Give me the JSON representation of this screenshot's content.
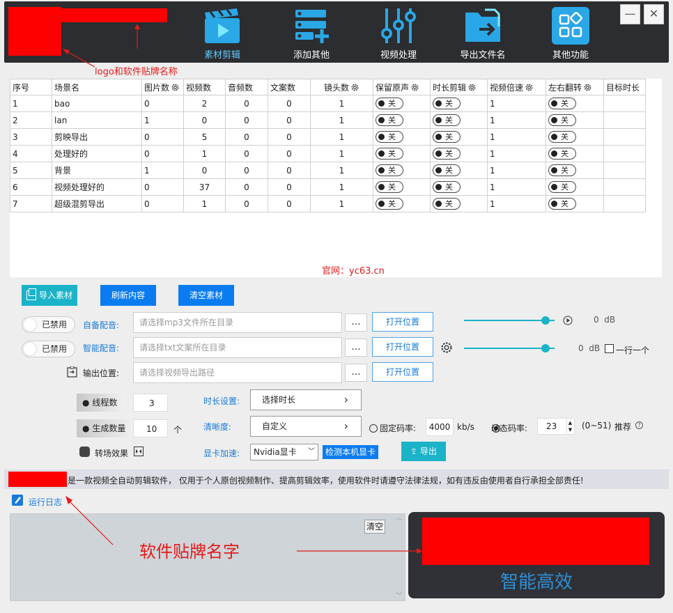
{
  "header": {
    "nav": [
      {
        "label": "素材剪辑",
        "icon": "clapperboard-play-icon",
        "active": true
      },
      {
        "label": "添加其他",
        "icon": "add-list-icon",
        "active": false
      },
      {
        "label": "视频处理",
        "icon": "sliders-icon",
        "active": false
      },
      {
        "label": "导出文件名",
        "icon": "folder-export-icon",
        "active": false
      },
      {
        "label": "其他功能",
        "icon": "grid-apps-icon",
        "active": false
      }
    ],
    "minimize": "—",
    "close": "✕"
  },
  "annotations": {
    "logo_note": "logo和软件贴牌名称",
    "brand_note": "软件贴牌名字",
    "website": "官网：yc63.cn"
  },
  "table": {
    "headers": [
      "序号",
      "场景名",
      "图片数",
      "视频数",
      "音频数",
      "文案数",
      "镜头数",
      "保留原声",
      "时长剪辑",
      "视频倍速",
      "左右翻转",
      "目标时长"
    ],
    "rows": [
      [
        "1",
        "bao",
        "0",
        "2",
        "0",
        "0",
        "1",
        "关",
        "关",
        "1",
        "关",
        ""
      ],
      [
        "2",
        "lan",
        "1",
        "0",
        "0",
        "0",
        "1",
        "关",
        "关",
        "1",
        "关",
        ""
      ],
      [
        "3",
        "剪映导出",
        "0",
        "5",
        "0",
        "0",
        "1",
        "关",
        "关",
        "1",
        "关",
        ""
      ],
      [
        "4",
        "处理好的",
        "0",
        "1",
        "0",
        "0",
        "1",
        "关",
        "关",
        "1",
        "关",
        ""
      ],
      [
        "5",
        "背景",
        "1",
        "0",
        "0",
        "0",
        "1",
        "关",
        "关",
        "1",
        "关",
        ""
      ],
      [
        "6",
        "视频处理好的",
        "0",
        "37",
        "0",
        "0",
        "1",
        "关",
        "关",
        "1",
        "关",
        ""
      ],
      [
        "7",
        "超级混剪导出",
        "0",
        "1",
        "0",
        "0",
        "1",
        "关",
        "关",
        "1",
        "关",
        ""
      ]
    ]
  },
  "actions": {
    "import": "导入素材",
    "refresh": "刷新内容",
    "clear": "清空素材"
  },
  "audio": {
    "self_toggle": "已禁用",
    "self_label": "自备配音:",
    "self_placeholder": "请选择mp3文件所在目录",
    "smart_toggle": "已禁用",
    "smart_label": "智能配音:",
    "smart_placeholder": "请选择txt文案所在目录",
    "browse": "...",
    "open": "打开位置",
    "db1": "0  dB",
    "db2": "0  dB",
    "one_by_one": "一行一个"
  },
  "output": {
    "label": "输出位置:",
    "placeholder": "请选择视频导出路径",
    "open": "打开位置"
  },
  "settings": {
    "threads_label": "线程数",
    "threads": "3",
    "count_label": "生成数量",
    "count": "10",
    "count_unit": "个",
    "transition_label": "转场效果",
    "duration_label": "时长设置:",
    "duration_value": "选择时长",
    "clarity_label": "清晰度:",
    "clarity_value": "自定义",
    "gpu_label": "显卡加速:",
    "gpu_value": "Nvidia显卡",
    "detect_gpu": "检测本机显卡",
    "export": "导出",
    "fixed_rate_label": "固定码率:",
    "fixed_rate": "4000",
    "rate_unit": "kb/s",
    "dynamic_rate_label": "动态码率:",
    "dynamic_rate": "23",
    "range": "(0~51)",
    "recommend": "推荐"
  },
  "disclaimer": "是一款视频全自动剪辑软件， 仅用于个人原创视频制作、提高剪辑效率，使用软件时请遵守法律法规，如有违反由使用者自行承担全部责任!",
  "log": {
    "title": "运行日志",
    "clear": "清空"
  },
  "promo": "智能高效",
  "colors": {
    "topbar": "#2b2d30",
    "accent_blue": "#0a7cf0",
    "accent_teal": "#1ab3c8",
    "redact": "#fe0000",
    "annotation": "#e31a1a",
    "promo_text": "#2d8fd5"
  }
}
